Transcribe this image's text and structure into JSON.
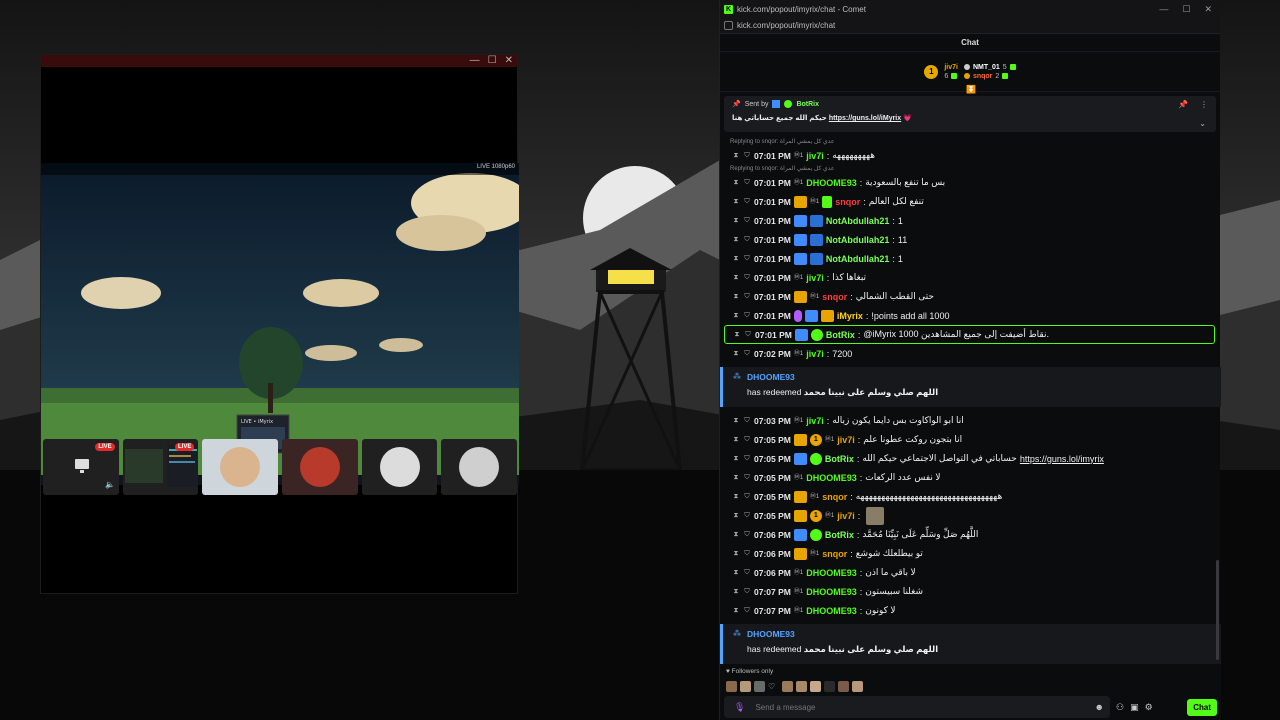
{
  "video_window": {
    "controls": [
      "—",
      "☐",
      "✕"
    ],
    "stream_overlay_text": "LIVE   1080p60",
    "thumbnails": [
      {
        "live": "LIVE"
      },
      {
        "live": "LIVE"
      },
      {
        "live": ""
      },
      {
        "live": ""
      },
      {
        "live": ""
      },
      {
        "live": ""
      }
    ]
  },
  "browser": {
    "title": "kick.com/popout/imyrix/chat - Comet",
    "url": "kick.com/popout/imyrix/chat"
  },
  "chat": {
    "header": "Chat",
    "leaderboard": {
      "rank": "1",
      "entries": [
        {
          "name": "jiv7i",
          "count": "6"
        },
        {
          "name": "NMT_01",
          "count": "5"
        },
        {
          "name": "snqor",
          "count": "2"
        }
      ]
    },
    "pinned": {
      "sent_by_label": "Sent by",
      "sender": "BotRix",
      "text": "حيكم الله جميع حساباتي هنا",
      "link": "https://guns.lol/iMyrix",
      "heart": "💗"
    },
    "reply_hints": [
      "Replying to snqor: عدي كل يمشي المراة",
      "Replying to snqor: عدي كل يمشي المراة"
    ],
    "messages": [
      {
        "time": "07:01 PM",
        "user": "jiv7i",
        "color": "#53fc18",
        "text": "هههههههههه"
      },
      {
        "time": "07:01 PM",
        "user": "DHOOME93",
        "color": "#53fc18",
        "text": "بس ما تنفع بالسعودية"
      },
      {
        "time": "07:01 PM",
        "user": "snqor",
        "color": "#ff3b3b",
        "text": "تنفع لكل العالم"
      },
      {
        "time": "07:01 PM",
        "user": "NotAbdullah21",
        "color": "#7bff5a",
        "text": "1"
      },
      {
        "time": "07:01 PM",
        "user": "NotAbdullah21",
        "color": "#7bff5a",
        "text": "11"
      },
      {
        "time": "07:01 PM",
        "user": "NotAbdullah21",
        "color": "#7bff5a",
        "text": "1"
      },
      {
        "time": "07:01 PM",
        "user": "jiv7i",
        "color": "#53fc18",
        "text": "تبغاها كذا"
      },
      {
        "time": "07:01 PM",
        "user": "snqor",
        "color": "#ff3b3b",
        "text": "حتى القطب الشمالي"
      },
      {
        "time": "07:01 PM",
        "user": "iMyrix",
        "color": "#ffd21a",
        "text": "!points add all 1000"
      },
      {
        "time": "07:01 PM",
        "user": "BotRix",
        "color": "#7bff5a",
        "text": "@iMyrix 1000 نقاط أضيفت إلى جميع المشاهدين."
      },
      {
        "time": "07:02 PM",
        "user": "jiv7i",
        "color": "#53fc18",
        "text": "7200"
      }
    ],
    "redeem1": {
      "user": "DHOOME93",
      "label": "has redeemed",
      "reward": "اللهم صلي وسلم على نبينا محمد"
    },
    "messages2": [
      {
        "time": "07:03 PM",
        "user": "jiv7i",
        "color": "#53fc18",
        "text": "انا ابو الواكاوت بس دايما يكون زباله"
      },
      {
        "time": "07:05 PM",
        "user": "jiv7i",
        "color": "#e8a400",
        "text": "انا بتجون روكت عطونا علم"
      },
      {
        "time": "07:05 PM",
        "user": "BotRix",
        "color": "#7bff5a",
        "text": "حساباتي في التواصل الاجتماعي حيكم الله",
        "link": "https://guns.lol/imyrix"
      },
      {
        "time": "07:05 PM",
        "user": "DHOOME93",
        "color": "#53fc18",
        "text": "لا نفس عدد الركعات"
      },
      {
        "time": "07:05 PM",
        "user": "snqor",
        "color": "#e8a400",
        "text": "ههههههههههههههههههههههههههههههههههه"
      },
      {
        "time": "07:05 PM",
        "user": "jiv7i",
        "color": "#e8a400",
        "text": ""
      },
      {
        "time": "07:06 PM",
        "user": "BotRix",
        "color": "#7bff5a",
        "text": "اللَّهُم صَلِّ وسَلِّم عَلَى نَبِيِّنَا مُحَمَّد"
      },
      {
        "time": "07:06 PM",
        "user": "snqor",
        "color": "#e8a400",
        "text": "تو بيطلعلك شوشع"
      },
      {
        "time": "07:06 PM",
        "user": "DHOOME93",
        "color": "#53fc18",
        "text": "لا باقي ما اذن"
      },
      {
        "time": "07:07 PM",
        "user": "DHOOME93",
        "color": "#53fc18",
        "text": "شغلنا سبيستون"
      },
      {
        "time": "07:07 PM",
        "user": "DHOOME93",
        "color": "#53fc18",
        "text": "لا كونون"
      }
    ],
    "redeem2": {
      "user": "DHOOME93",
      "label": "has redeemed",
      "reward": "اللهم صلي وسلم على نبينا محمد"
    },
    "footer": {
      "followers_only": "Followers only",
      "input_placeholder": "Send a message",
      "chat_button": "Chat"
    }
  },
  "icons": [
    "kick-logo",
    "pin-icon",
    "more-icon",
    "chevron-down-icon",
    "hourglass-icon",
    "shield-icon",
    "mic-icon",
    "emoji-icon",
    "link-icon",
    "settings-icon",
    "redeem-icon"
  ]
}
